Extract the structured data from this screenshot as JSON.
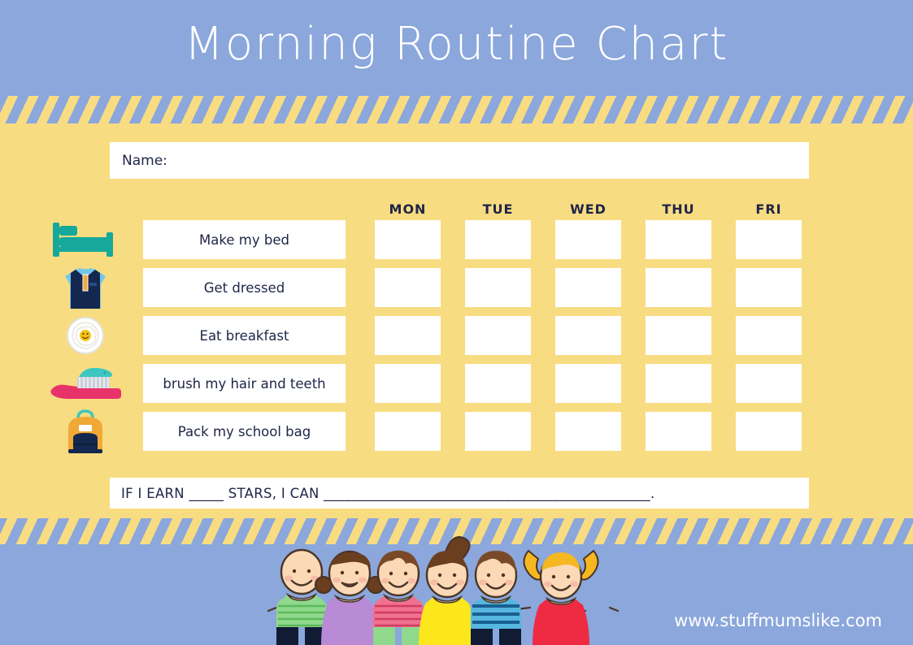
{
  "header": {
    "title": "Morning Routine Chart",
    "bg_color": "#8ba7dc",
    "title_color": "#ffffff"
  },
  "colors": {
    "blue": "#8ba7dc",
    "yellow": "#f8dc82",
    "navy_text": "#1f2547",
    "white": "#ffffff",
    "bed_teal": "#16a89a",
    "shirt_navy": "#14274e",
    "shirt_lightblue": "#73c8e8",
    "toothbrush_pink": "#e8336a",
    "toothpaste_teal": "#3fc6c0",
    "backpack_orange": "#f0a936",
    "backpack_navy": "#14274e",
    "egg_yolk": "#f5c518"
  },
  "name_field": {
    "label": "Name:",
    "value": "",
    "placeholder": ""
  },
  "days": [
    "MON",
    "TUE",
    "WED",
    "THU",
    "FRI"
  ],
  "tasks": [
    {
      "icon": "bed-icon",
      "label": "Make my bed"
    },
    {
      "icon": "shirt-icon",
      "label": "Get dressed"
    },
    {
      "icon": "fried-egg-icon",
      "label": "Eat breakfast"
    },
    {
      "icon": "toothbrush-icon",
      "label": "brush my hair and teeth"
    },
    {
      "icon": "backpack-icon",
      "label": "Pack my school bag"
    }
  ],
  "reward": {
    "text": "IF I EARN _____ STARS, I CAN _______________________________________________."
  },
  "footer": {
    "illustration": "six-children-holding-hands",
    "url": "www.stuffmumslike.com"
  }
}
